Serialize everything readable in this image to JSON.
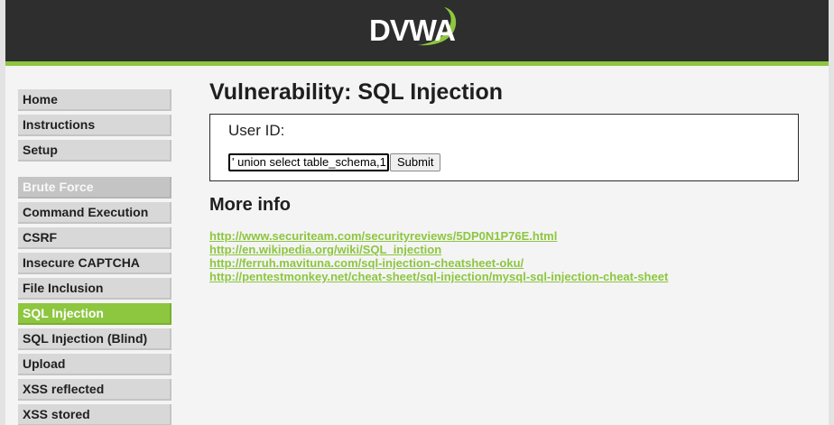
{
  "header": {
    "logo_text": "DVWA"
  },
  "sidebar": {
    "group1": [
      {
        "label": "Home"
      },
      {
        "label": "Instructions"
      },
      {
        "label": "Setup"
      }
    ],
    "group2": [
      {
        "label": "Brute Force",
        "state": "disabled"
      },
      {
        "label": "Command Execution"
      },
      {
        "label": "CSRF"
      },
      {
        "label": "Insecure CAPTCHA"
      },
      {
        "label": "File Inclusion"
      },
      {
        "label": "SQL Injection",
        "state": "active"
      },
      {
        "label": "SQL Injection (Blind)"
      },
      {
        "label": "Upload"
      },
      {
        "label": "XSS reflected"
      },
      {
        "label": "XSS stored"
      }
    ]
  },
  "main": {
    "title": "Vulnerability: SQL Injection",
    "form": {
      "label": "User ID:",
      "input_value": "' union select table_schema,1",
      "submit_label": "Submit"
    },
    "more_info_title": "More info",
    "links": [
      "http://www.securiteam.com/securityreviews/5DP0N1P76E.html",
      "http://en.wikipedia.org/wiki/SQL_injection",
      "http://ferruh.mavituna.com/sql-injection-cheatsheet-oku/",
      "http://pentestmonkey.net/cheat-sheet/sql-injection/mysql-sql-injection-cheat-sheet"
    ]
  },
  "colors": {
    "accent": "#8dc63f",
    "header_bg": "#2e2e2e",
    "page_bg": "#f4f4f4",
    "menu_bg": "#d8d8d8"
  }
}
